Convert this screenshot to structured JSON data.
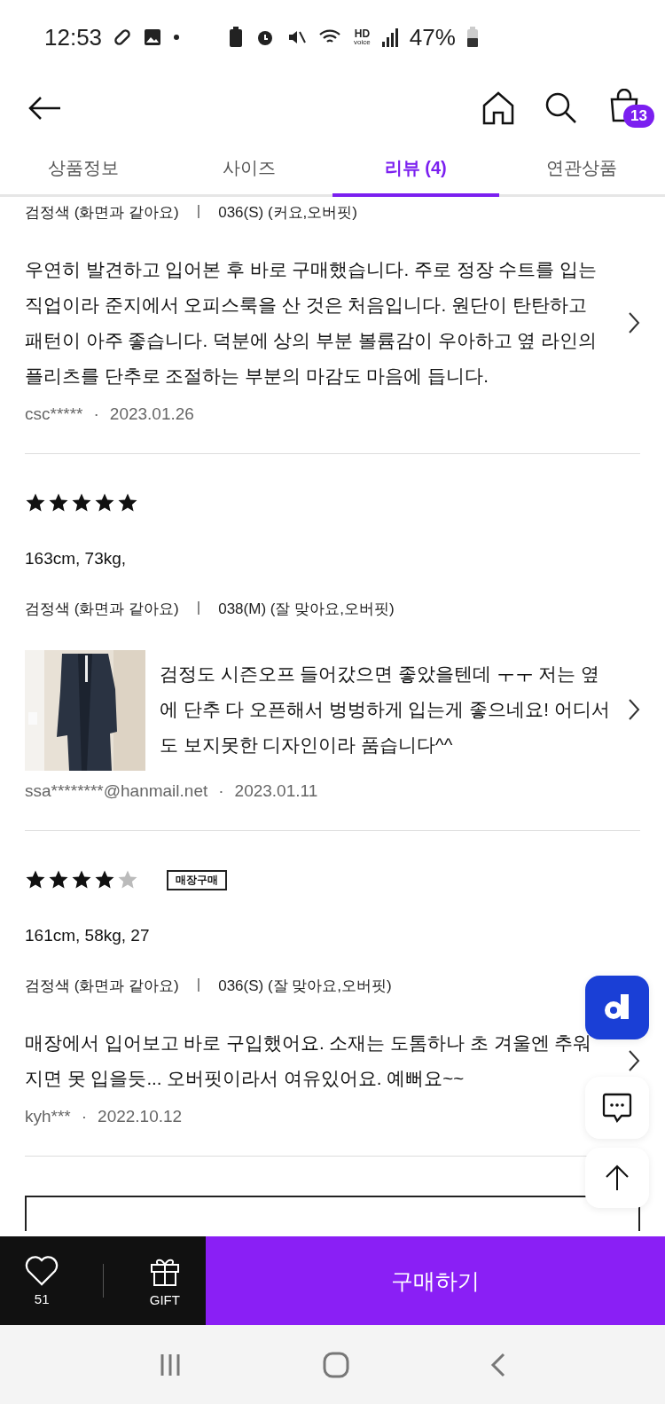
{
  "status_bar": {
    "time": "12:53",
    "hd": "HD",
    "hd_sub": "voice",
    "battery": "47%"
  },
  "header": {
    "cart_count": "13"
  },
  "tabs": [
    {
      "label": "상품정보",
      "selected": false
    },
    {
      "label": "사이즈",
      "selected": false
    },
    {
      "label": "리뷰 (4)",
      "selected": true
    },
    {
      "label": "연관상품",
      "selected": false
    }
  ],
  "reviews": [
    {
      "options": "검정색 (화면과 같아요)",
      "divider": "|",
      "dot": "·",
      "size": "036(S) (커요,오버핏)",
      "text": "우연히 발견하고 입어본 후 바로 구매했습니다. 주로 정장 수트를 입는 직업이라 준지에서 오피스룩을 산 것은 처음입니다. 원단이 탄탄하고 패턴이 아주 좋습니다. 덕분에 상의 부분 볼륨감이 우아하고 옆 라인의 플리츠를 단추로 조절하는 부분의 마감도 마음에 듭니다.",
      "author": "csc*****",
      "date": "2023.01.26"
    },
    {
      "stars": 5,
      "body": "163cm, 73kg,",
      "options": "검정색 (화면과 같아요)",
      "divider": "|",
      "dot": "·",
      "size": "038(M) (잘 맞아요,오버핏)",
      "text": "검정도 시즌오프 들어갔으면 좋았을텐데 ㅜㅜ 저는 옆에 단추 다 오픈해서 벙벙하게 입는게 좋으네요! 어디서도 보지못한 디자인이라 품습니다^^",
      "author": "ssa********@hanmail.net",
      "date": "2023.01.11"
    },
    {
      "stars": 4,
      "badge": "매장구매",
      "body": "161cm, 58kg, 27",
      "options": "검정색 (화면과 같아요)",
      "divider": "|",
      "dot": "·",
      "size": "036(S) (잘 맞아요,오버핏)",
      "text": "매장에서 입어보고 바로 구입했어요. 소재는 도톰하나 초 겨울엔 추워지면 못 입을듯... 오버핏이라서 여유있어요. 예뻐요~~",
      "author": "kyh***",
      "date": "2022.10.12"
    }
  ],
  "bottom_bar": {
    "likes": "51",
    "gift": "GIFT",
    "buy": "구매하기"
  }
}
